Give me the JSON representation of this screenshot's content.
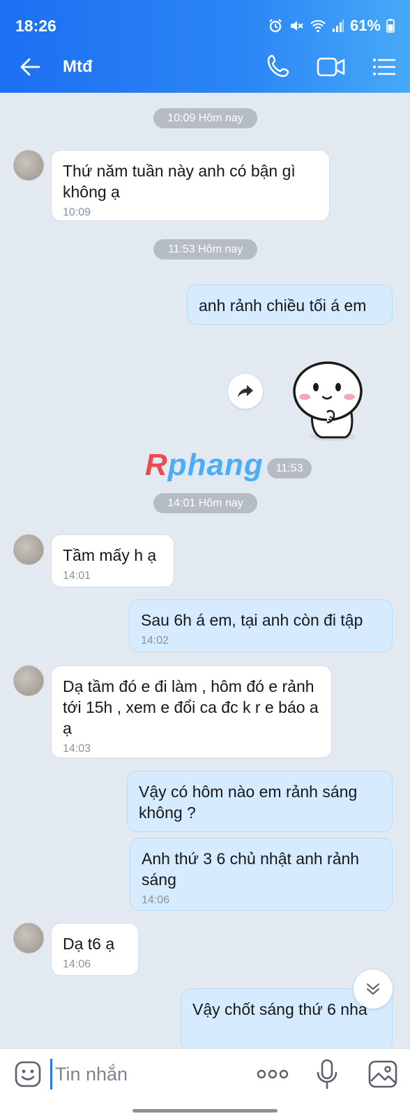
{
  "status_bar": {
    "time": "18:26",
    "battery": "61%"
  },
  "header": {
    "title": "Mtđ"
  },
  "chat": {
    "separators": [
      "10:09 Hôm nay",
      "11:53 Hôm nay",
      "14:01 Hôm nay"
    ],
    "messages": [
      {
        "text": "Thứ năm tuần này anh có bận gì không ạ",
        "time": "10:09"
      },
      {
        "text": "anh rảnh chiều tối á em"
      },
      {
        "sticker": "bunny-sticker",
        "time": "11:53"
      },
      {
        "text": "Tầm mấy h ạ",
        "time": "14:01"
      },
      {
        "text": "Sau 6h á em, tại anh còn đi tập",
        "time": "14:02"
      },
      {
        "text": "Dạ tầm đó e đi làm , hôm đó e rảnh tới 15h , xem e đổi ca đc k r e báo a ạ",
        "time": "14:03"
      },
      {
        "text": "Vậy có hôm nào em rảnh sáng không ?"
      },
      {
        "text": "Anh thứ 3 6 chủ nhật anh rảnh sáng",
        "time": "14:06"
      },
      {
        "text": "Dạ t6 ạ",
        "time": "14:06"
      },
      {
        "text": "Vậy chốt sáng thứ 6 nha"
      }
    ]
  },
  "watermark": {
    "first": "R",
    "rest": "phang"
  },
  "input_bar": {
    "placeholder": "Tin nhắn"
  },
  "icons": [
    "back-arrow-icon",
    "phone-icon",
    "video-icon",
    "list-icon",
    "forward-icon",
    "chevron-down-icon",
    "emoji-icon",
    "more-dots-icon",
    "mic-icon",
    "image-icon"
  ]
}
